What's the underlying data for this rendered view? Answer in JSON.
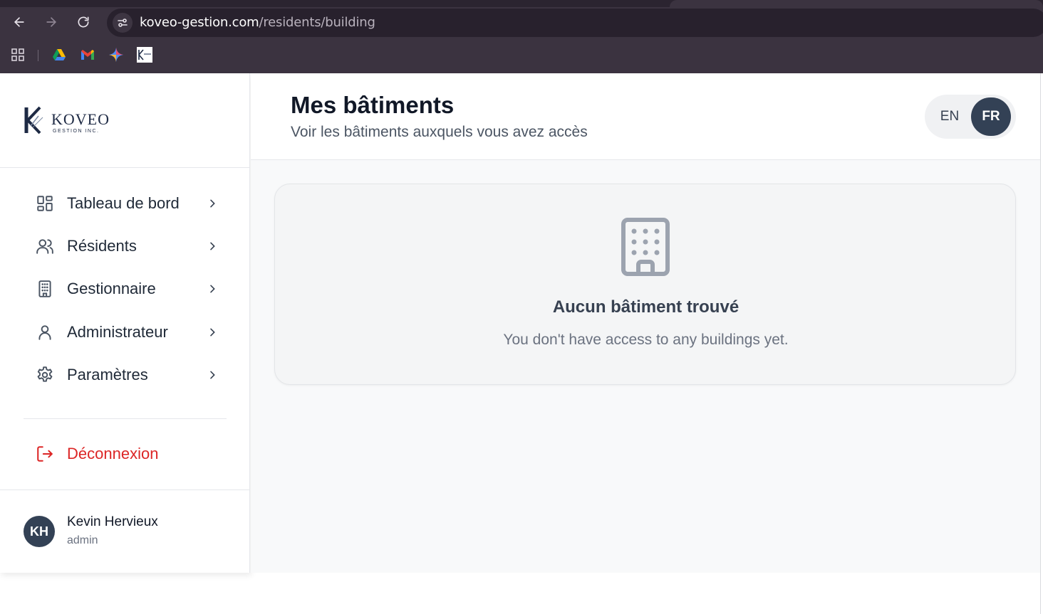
{
  "browser": {
    "url_host": "koveo-gestion.com",
    "url_path": "/residents/building",
    "bookmarks": [
      "apps-icon",
      "google-drive-icon",
      "gmail-icon",
      "gemini-icon",
      "koveo-favicon"
    ]
  },
  "sidebar": {
    "logo_text": "KOVEO",
    "logo_subtext": "GESTION INC.",
    "items": [
      {
        "label": "Tableau de bord",
        "icon": "dashboard-icon"
      },
      {
        "label": "Résidents",
        "icon": "users-icon"
      },
      {
        "label": "Gestionnaire",
        "icon": "building-icon"
      },
      {
        "label": "Administrateur",
        "icon": "user-icon"
      },
      {
        "label": "Paramètres",
        "icon": "settings-icon"
      }
    ],
    "logout_label": "Déconnexion",
    "user": {
      "initials": "KH",
      "name": "Kevin Hervieux",
      "role": "admin"
    }
  },
  "header": {
    "title": "Mes bâtiments",
    "subtitle": "Voir les bâtiments auxquels vous avez accès",
    "lang_en": "EN",
    "lang_fr": "FR",
    "active_lang": "FR"
  },
  "empty_state": {
    "icon": "building-icon",
    "title": "Aucun bâtiment trouvé",
    "message": "You don't have access to any buildings yet."
  },
  "colors": {
    "accent": "#334155",
    "danger": "#dc2626",
    "chrome": "#3b3340"
  }
}
